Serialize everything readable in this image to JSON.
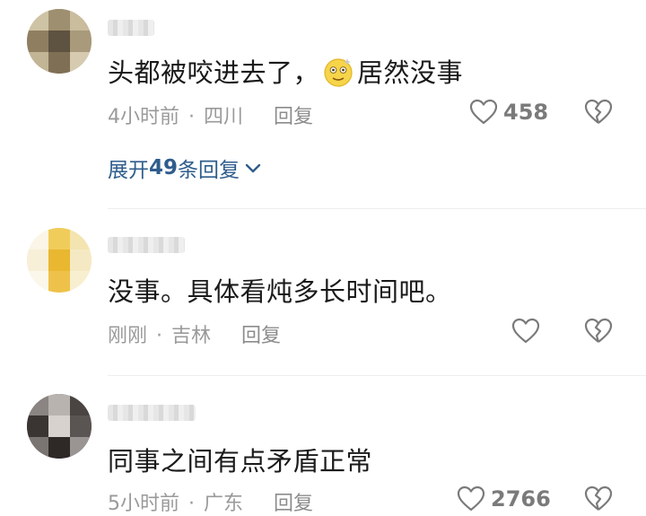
{
  "comments": [
    {
      "text_before_emoji": "头都被咬进去了，",
      "emoji": "dizzy-face-emoji",
      "text_after_emoji": "居然没事",
      "time": "4小时前",
      "location": "四川",
      "reply_label": "回复",
      "likes": "458",
      "expand_prefix": "展开",
      "expand_count": "49",
      "expand_suffix": "条回复"
    },
    {
      "text": "没事。具体看炖多长时间吧。",
      "time": "刚刚",
      "location": "吉林",
      "reply_label": "回复"
    },
    {
      "text": "同事之间有点矛盾正常",
      "time": "5小时前",
      "location": "广东",
      "reply_label": "回复",
      "likes": "2766"
    }
  ],
  "colors": {
    "text": "#1a1a1a",
    "meta": "#9a9a9a",
    "link": "#2f5d8c",
    "icon": "#7a7a7a"
  },
  "icons": [
    "heart-icon",
    "broken-heart-icon",
    "chevron-down-icon"
  ]
}
